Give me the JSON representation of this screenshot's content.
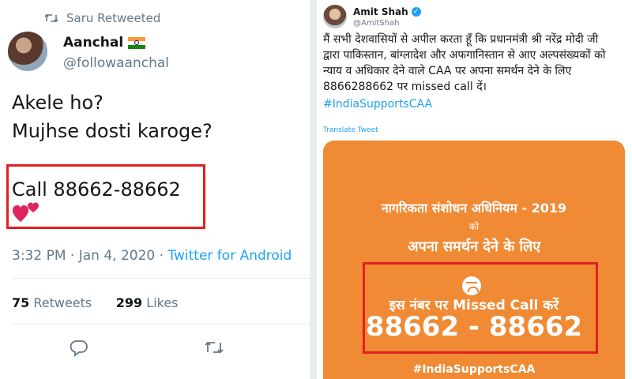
{
  "left_tweet": {
    "retweet_label": "Saru Retweeted",
    "author_name": "Aanchal",
    "author_handle": "@followaanchal",
    "lines": [
      "Akele ho?",
      "Mujhse dosti karoge?"
    ],
    "call_line": "Call 88662-88662",
    "meta_time": "3:32 PM · Jan 4, 2020 · ",
    "meta_source": "Twitter for Android",
    "retweets_count": "75",
    "retweets_label": "Retweets",
    "likes_count": "299",
    "likes_label": "Likes",
    "icons": [
      "retweet-icon",
      "flag-india-icon",
      "hearts-icon",
      "reply-icon",
      "retweet-action-icon"
    ],
    "colors": {
      "link": "#1da1f2",
      "highlight": "#e02020"
    }
  },
  "right_tweet": {
    "author_name": "Amit Shah",
    "author_handle": "@AmitShah",
    "body_lines": [
      "मैं सभी देशवासियों से अपील करता हूँ कि प्रधानमंत्री श्री नरेंद्र मोदी जी",
      "द्वारा पाकिस्तान, बांग्लादेश और अफगानिस्तान से आए अल्पसंख्यकों को",
      "न्याय व अधिकार देने वाले CAA पर अपना समर्थन देने के लिए",
      "8866288662 पर missed call दें।"
    ],
    "hashtag": "#IndiaSupportsCAA",
    "translate_label": "Translate Tweet",
    "poster": {
      "line1": "नागरिकता संशोधन अधिनियम - 2019",
      "line2": "को",
      "line3": "अपना समर्थन देने के लिए",
      "line4": "इस नंबर पर Missed Call करें",
      "number": "88662 - 88662",
      "hashtag": "#IndiaSupportsCAA",
      "colors": {
        "background": "#f08a34",
        "text": "#ffffff",
        "highlight": "#e02020"
      }
    }
  }
}
